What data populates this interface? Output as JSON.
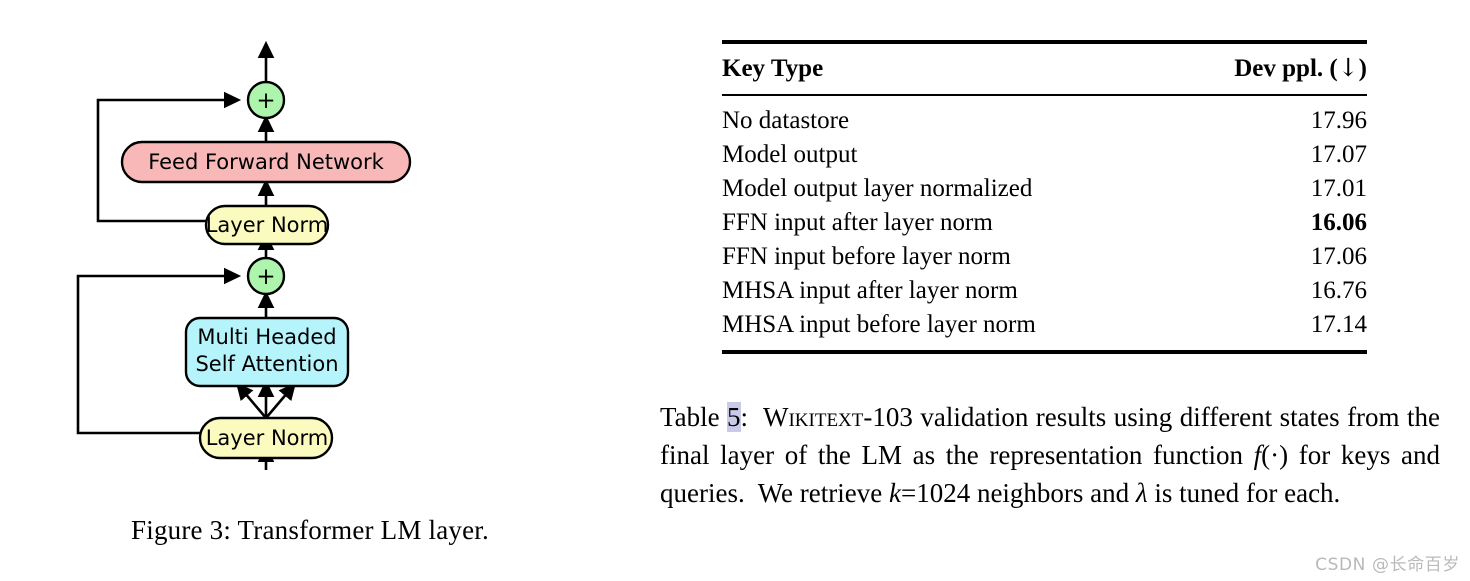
{
  "figure": {
    "caption": "Figure 3: Transformer LM layer.",
    "nodes": {
      "ffn": "Feed Forward Network",
      "layer_norm_top": "Layer Norm",
      "mhsa_line1": "Multi Headed",
      "mhsa_line2": "Self Attention",
      "layer_norm_bottom": "Layer Norm",
      "add_top": "+",
      "add_bottom": "+"
    },
    "colors": {
      "ffn_fill": "#f9b8b8",
      "layer_norm_fill": "#fbfbbf",
      "mhsa_fill": "#b6f4fb",
      "add_fill": "#adf5ad",
      "stroke": "#000000"
    }
  },
  "table": {
    "columns": [
      {
        "key": "key_type",
        "label": "Key Type",
        "align": "left"
      },
      {
        "key": "dev_ppl",
        "label": "Dev ppl. (↓)",
        "align": "right"
      }
    ],
    "header_dev_prefix": "Dev ppl. (",
    "header_dev_arrow": "↓",
    "header_dev_suffix": ")",
    "rows": [
      {
        "key_type": "No datastore",
        "dev_ppl": "17.96",
        "bold": false
      },
      {
        "key_type": "Model output",
        "dev_ppl": "17.07",
        "bold": false
      },
      {
        "key_type": "Model output layer normalized",
        "dev_ppl": "17.01",
        "bold": false
      },
      {
        "key_type": "FFN input after layer norm",
        "dev_ppl": "16.06",
        "bold": true
      },
      {
        "key_type": "FFN input before layer norm",
        "dev_ppl": "17.06",
        "bold": false
      },
      {
        "key_type": "MHSA input after layer norm",
        "dev_ppl": "16.76",
        "bold": false
      },
      {
        "key_type": "MHSA input before layer norm",
        "dev_ppl": "17.14",
        "bold": false
      }
    ],
    "caption": {
      "label": "Table",
      "number": "5",
      "colon": ":",
      "part1": "  ",
      "smallcaps_word": "Wikitext",
      "part2": "-103 validation results using different states from the final layer of the LM as the representation function ",
      "math_f": "f",
      "part3": "(·) for keys and queries.  We retrieve ",
      "math_k": "k",
      "part4": "=1024 neighbors and ",
      "math_lambda": "λ",
      "part5": " is tuned for each."
    }
  },
  "watermark": "CSDN @长命百岁"
}
